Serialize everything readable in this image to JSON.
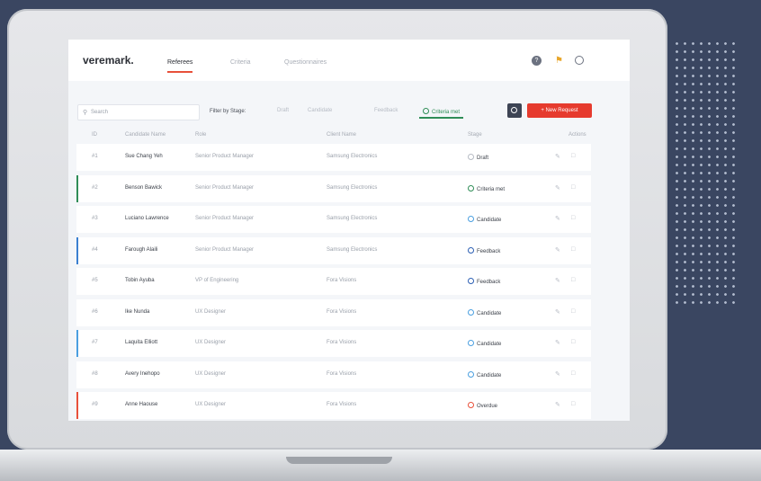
{
  "app": {
    "logo": "veremark.",
    "tabs": [
      {
        "label": "Referees",
        "active": true
      },
      {
        "label": "Criteria",
        "active": false
      },
      {
        "label": "Questionnaires",
        "active": false
      }
    ]
  },
  "toolbar": {
    "search_placeholder": "Search",
    "filter_label": "Filter by Stage:",
    "filters": [
      "Draft",
      "Candidate",
      "Feedback",
      "Criteria met"
    ],
    "active_filter": "Criteria met",
    "new_button": "+  New Request"
  },
  "table": {
    "columns": [
      "ID",
      "Candidate Name",
      "Role",
      "Client Name",
      "Stage",
      "Actions"
    ],
    "rows": [
      {
        "id": "#1",
        "name": "Sue Chang Yeh",
        "role": "Senior Product Manager",
        "client": "Samsung Electronics",
        "stage": "Draft",
        "accent": "",
        "stage_color": "#b6bbc4"
      },
      {
        "id": "#2",
        "name": "Benson Bawick",
        "role": "Senior Product Manager",
        "client": "Samsung Electronics",
        "stage": "Criteria met",
        "accent": "#2f8d57",
        "stage_color": "#2f8d57"
      },
      {
        "id": "#3",
        "name": "Luciano Lawrence",
        "role": "Senior Product Manager",
        "client": "Samsung Electronics",
        "stage": "Candidate",
        "accent": "",
        "stage_color": "#4a9fe0"
      },
      {
        "id": "#4",
        "name": "Farough Alaili",
        "role": "Senior Product Manager",
        "client": "Samsung Electronics",
        "stage": "Feedback",
        "accent": "#3a7fd0",
        "stage_color": "#2c5fb3"
      },
      {
        "id": "#5",
        "name": "Tobin Ayuba",
        "role": "VP of Engineering",
        "client": "Fora Visions",
        "stage": "Feedback",
        "accent": "",
        "stage_color": "#2c5fb3"
      },
      {
        "id": "#6",
        "name": "Ike Nunda",
        "role": "UX Designer",
        "client": "Fora Visions",
        "stage": "Candidate",
        "accent": "",
        "stage_color": "#4a9fe0"
      },
      {
        "id": "#7",
        "name": "Laquita Elliott",
        "role": "UX Designer",
        "client": "Fora Visions",
        "stage": "Candidate",
        "accent": "#4a9fe0",
        "stage_color": "#4a9fe0"
      },
      {
        "id": "#8",
        "name": "Avery Inehopo",
        "role": "UX Designer",
        "client": "Fora Visions",
        "stage": "Candidate",
        "accent": "",
        "stage_color": "#4a9fe0"
      },
      {
        "id": "#9",
        "name": "Anne Haouse",
        "role": "UX Designer",
        "client": "Fora Visions",
        "stage": "Overdue",
        "accent": "#e8503a",
        "stage_color": "#e8503a"
      }
    ]
  }
}
